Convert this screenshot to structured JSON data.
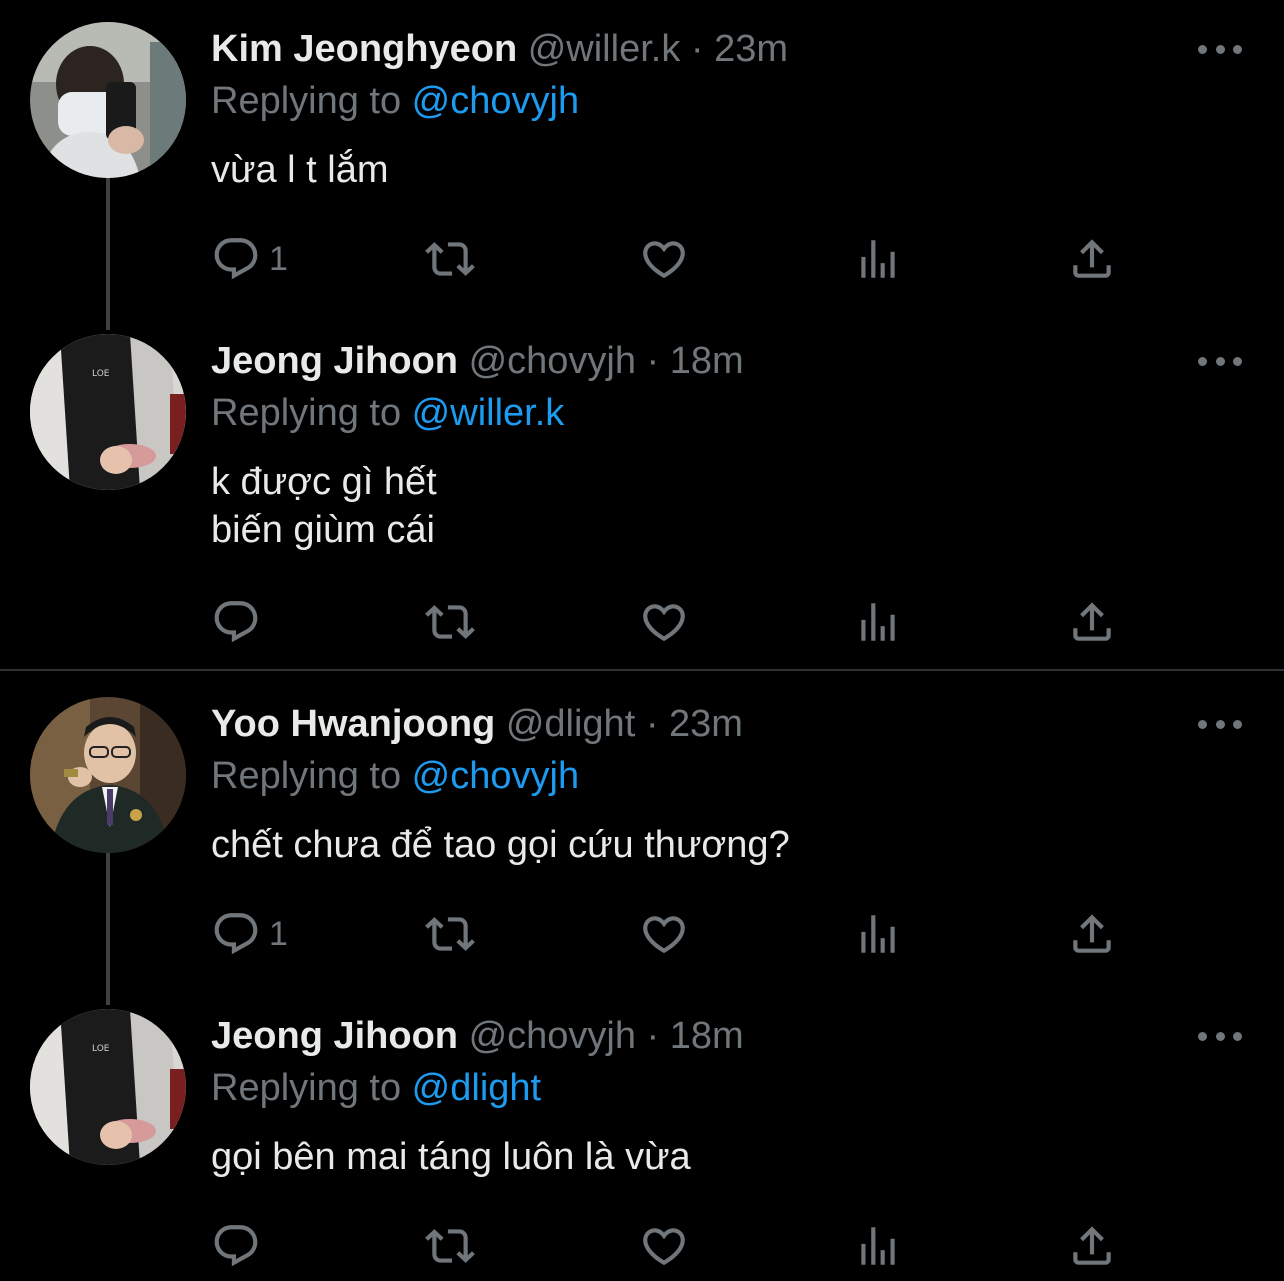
{
  "tweets": [
    {
      "name": "Kim Jeonghyeon",
      "handle": "@willer.k",
      "dot": "·",
      "time": "23m",
      "replying_prefix": "Replying to ",
      "replying_to": "@chovyjh",
      "text": "vừa l t lắm",
      "reply_count": "1",
      "avatar": "selfie-mask-icon"
    },
    {
      "name": "Jeong Jihoon",
      "handle": "@chovyjh",
      "dot": "·",
      "time": "18m",
      "replying_prefix": "Replying to ",
      "replying_to": "@willer.k",
      "text": "k được gì hết\nbiến giùm cái",
      "reply_count": "",
      "avatar": "jacket-person-icon"
    },
    {
      "name": "Yoo Hwanjoong",
      "handle": "@dlight",
      "dot": "·",
      "time": "23m",
      "replying_prefix": "Replying to ",
      "replying_to": "@chovyjh",
      "text": "chết chưa để tao gọi cứu thương?",
      "reply_count": "1",
      "avatar": "suit-person-icon"
    },
    {
      "name": "Jeong Jihoon",
      "handle": "@chovyjh",
      "dot": "·",
      "time": "18m",
      "replying_prefix": "Replying to ",
      "replying_to": "@dlight",
      "text": "gọi bên mai táng luôn là vừa",
      "reply_count": "",
      "avatar": "jacket-person-icon"
    }
  ],
  "colors": {
    "background": "#000000",
    "primary_text": "#e7e9ea",
    "secondary_text": "#71767b",
    "accent": "#1d9bf0",
    "thread_line": "#3e4144"
  }
}
